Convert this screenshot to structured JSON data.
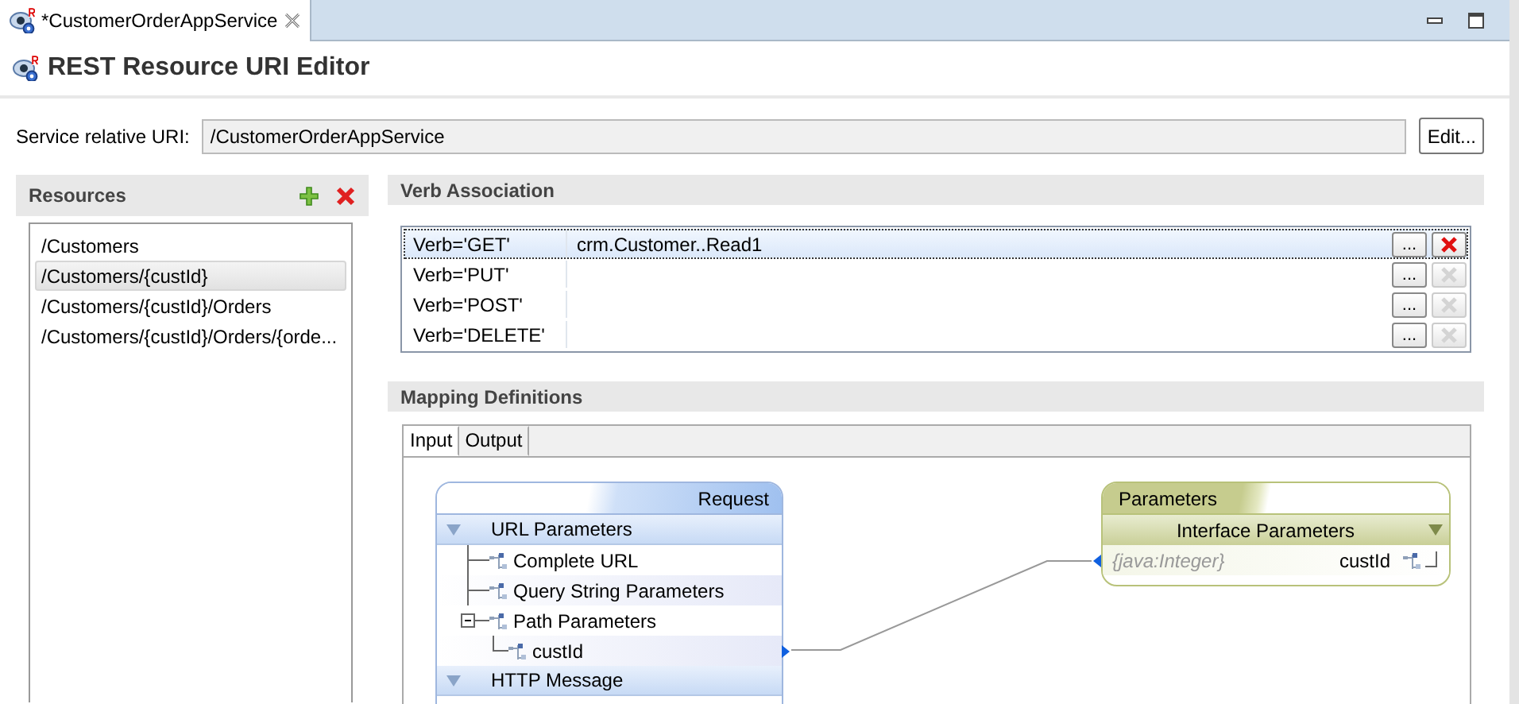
{
  "editor_tab": {
    "title": "*CustomerOrderAppService"
  },
  "page_title": "REST Resource URI Editor",
  "service_uri": {
    "label": "Service relative URI:",
    "value": "/CustomerOrderAppService",
    "button": "Edit..."
  },
  "resources": {
    "title": "Resources",
    "items": [
      {
        "label": "/Customers",
        "selected": false
      },
      {
        "label": "/Customers/{custId}",
        "selected": true
      },
      {
        "label": "/Customers/{custId}/Orders",
        "selected": false
      },
      {
        "label": "/Customers/{custId}/Orders/{orde...",
        "selected": false
      }
    ]
  },
  "verb_association": {
    "title": "Verb Association",
    "rows": [
      {
        "verb": "Verb='GET'",
        "operation": "crm.Customer..Read1",
        "selected": true,
        "browse_button": "...",
        "delete_disabled": false
      },
      {
        "verb": "Verb='PUT'",
        "selected": false,
        "browse_button": "...",
        "delete_disabled": true
      },
      {
        "verb": "Verb='POST'",
        "selected": false,
        "browse_button": "...",
        "delete_disabled": true
      },
      {
        "verb": "Verb='DELETE'",
        "selected": false,
        "browse_button": "...",
        "delete_disabled": true
      }
    ]
  },
  "mapping_definitions": {
    "title": "Mapping Definitions",
    "tabs": [
      {
        "label": "Input",
        "selected": true
      },
      {
        "label": "Output",
        "selected": false
      }
    ],
    "request": {
      "title": "Request",
      "groups": [
        {
          "label": "URL Parameters",
          "expanded": true,
          "children": [
            {
              "label": "Complete URL"
            },
            {
              "label": "Query String Parameters"
            },
            {
              "label": "Path Parameters",
              "expanded": true,
              "children": [
                {
                  "label": "custId"
                }
              ]
            }
          ]
        },
        {
          "label": "HTTP Message",
          "expanded": true
        }
      ]
    },
    "parameters": {
      "title": "Parameters",
      "header": "Interface Parameters",
      "rows": [
        {
          "type": "{java:Integer}",
          "name": "custId"
        }
      ]
    }
  }
}
